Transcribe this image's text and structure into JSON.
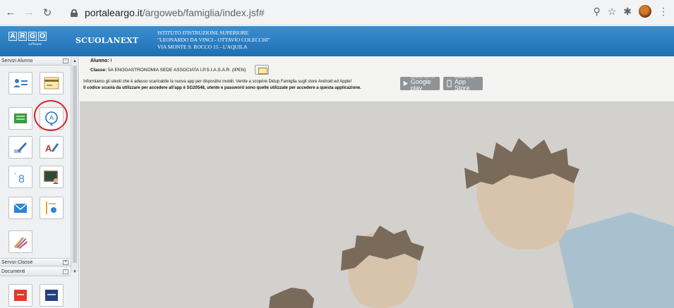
{
  "browser": {
    "url_host": "portaleargo.it",
    "url_path": "/argoweb/famiglia/index.jsf#"
  },
  "header": {
    "logo_letters": [
      "A",
      "R",
      "G",
      "O"
    ],
    "logo_sub": "software",
    "product": "SCUOLANEXT",
    "school_line1": "ISTITUTO D'ISTRUZIONE SUPERIORE",
    "school_line2": "\"LEONARDO DA VINCI - OTTAVIO COLECCHI\"",
    "school_line3": "VIA MONTE S. ROCCO 15 - L'AQUILA"
  },
  "sidebar": {
    "panel_alunno": "Servizi Alunno",
    "panel_classe": "Servizi Classe",
    "panel_documenti": "Documenti",
    "toggle_minus": "−",
    "toggle_plus": "+",
    "tiles": [
      {
        "name": "anagrafe-tile",
        "icon": "id-card-icon"
      },
      {
        "name": "tasse-tile",
        "icon": "payment-card-icon"
      },
      {
        "name": "curriculum-tile",
        "icon": "green-book-icon"
      },
      {
        "name": "assenze-tile",
        "icon": "attendance-icon"
      },
      {
        "name": "note-tile",
        "icon": "pencil-note-icon"
      },
      {
        "name": "voti-tile",
        "icon": "grades-icon"
      },
      {
        "name": "scrutinio-tile",
        "icon": "number-eight-icon"
      },
      {
        "name": "orario-tile",
        "icon": "blackboard-icon"
      },
      {
        "name": "comunicazioni-tile",
        "icon": "envelope-icon"
      },
      {
        "name": "docenti-tile",
        "icon": "teacher-list-icon"
      },
      {
        "name": "argomenti-tile",
        "icon": "colored-pencils-icon"
      },
      {
        "name": "documento-1-tile",
        "icon": "red-document-icon"
      },
      {
        "name": "documento-2-tile",
        "icon": "blue-document-icon"
      }
    ]
  },
  "main": {
    "alunno_label": "Alunno:",
    "alunno_value": "I",
    "classe_label": "Classe:",
    "classe_value": "5A ENOGASTRONOMIA SEDE ASSOCIATA I.P.S.I.A.S.A.R. (IPEN)",
    "notice_line1": "Informiamo gli utenti che è adesso scaricabile la nuova app per dispositivi mobili. Venite a scoprire Didup Famiglia sugli store Android ed Apple!",
    "notice_line2": "Il codice scuola da utilizzare per accedere all'app è SG20548, utente e password sono quelle utilizzate per accedere a questa applicazione.",
    "google_small": "ANDROID APP ON",
    "google_name": "Google play",
    "apple_small": "Available on the",
    "apple_name": "App Store"
  }
}
